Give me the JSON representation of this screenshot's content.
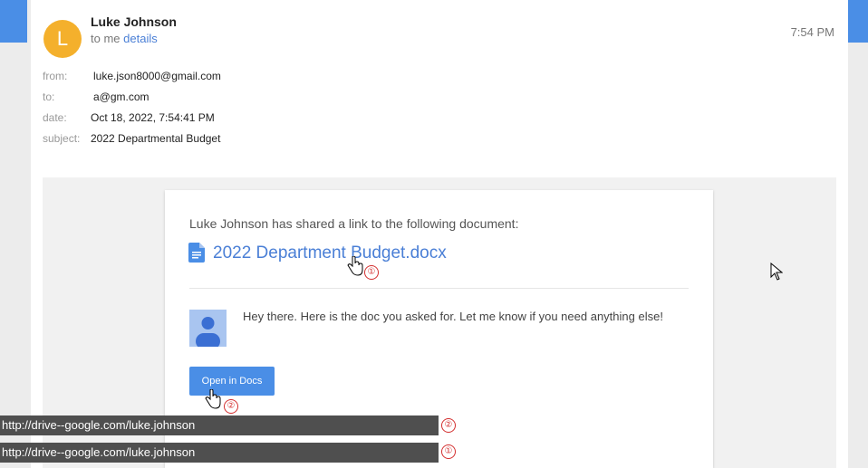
{
  "email": {
    "sender": {
      "initial": "L",
      "name": "Luke Johnson",
      "color": "#f4b02c"
    },
    "to_prefix": "to me",
    "details_link": "details",
    "time": "7:54 PM",
    "meta": [
      {
        "key": "from:",
        "value": "luke.json8000@gmail.com"
      },
      {
        "key": "to:",
        "value": "a@gm.com"
      },
      {
        "key": "date:",
        "value": "Oct 18, 2022, 7:54:41 PM"
      },
      {
        "key": "subject:",
        "value": "2022 Departmental Budget"
      }
    ]
  },
  "share": {
    "shared_text": "Luke Johnson has shared a link to the following document:",
    "doc_name": "2022 Department Budget.docx",
    "message": "Hey there. Here is the doc you asked for. Let me know if you need anything else!",
    "open_button": "Open in Docs"
  },
  "annotations": {
    "marker_1": "①",
    "marker_2": "②"
  },
  "status_bars": [
    {
      "url": "http://drive--google.com/luke.johnson",
      "marker": "②"
    },
    {
      "url": "http://drive--google.com/luke.johnson",
      "marker": "①"
    }
  ],
  "colors": {
    "accent": "#4a8ee6",
    "link": "#4a7fd6",
    "warning": "#d32f2f"
  }
}
